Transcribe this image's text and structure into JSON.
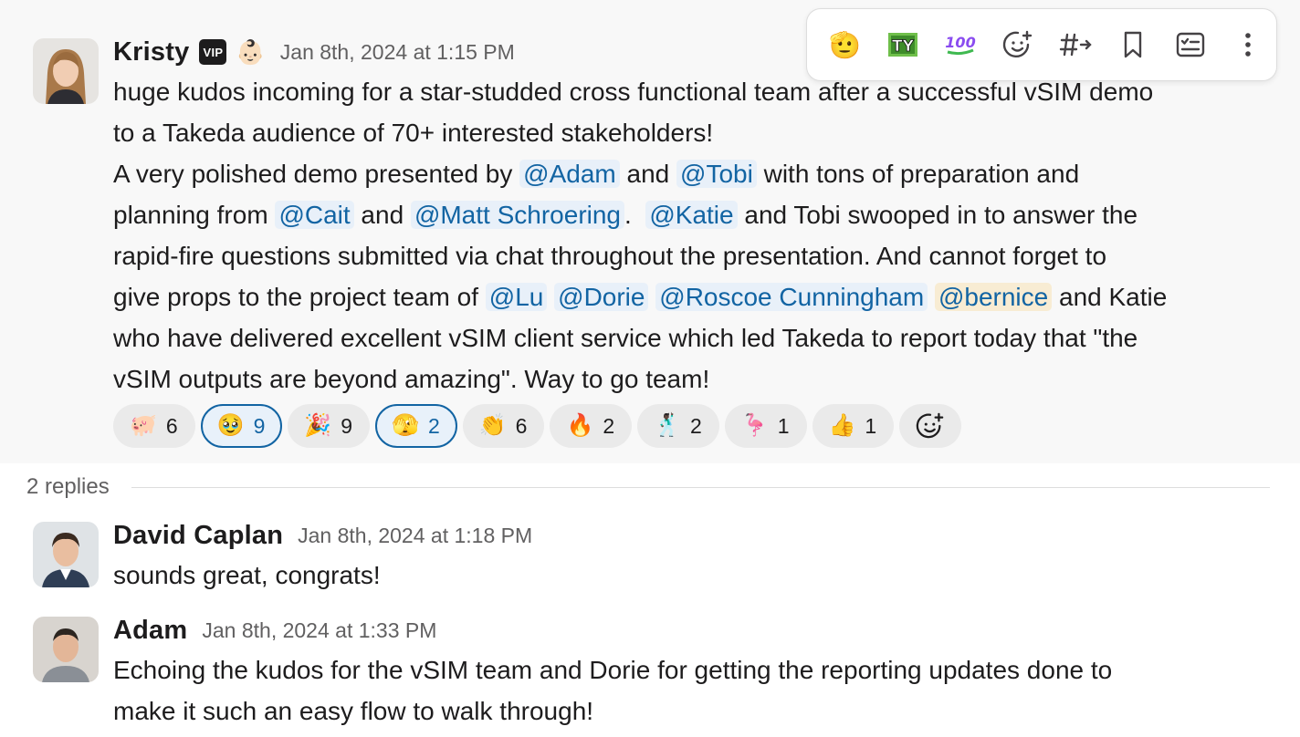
{
  "main_message": {
    "author": "Kristy",
    "badge": "VIP",
    "status_emoji": "👶🏻",
    "timestamp": "Jan 8th, 2024 at 1:15 PM",
    "lines": [
      [
        {
          "t": "huge kudos incoming for a star-studded cross functional team after a successful vSIM demo"
        }
      ],
      [
        {
          "t": "to a Takeda audience of 70+ interested stakeholders!"
        }
      ],
      [
        {
          "t": "A very polished demo presented by "
        },
        {
          "m": "@Adam"
        },
        {
          "t": " and "
        },
        {
          "m": "@Tobi"
        },
        {
          "t": " with tons of preparation and"
        }
      ],
      [
        {
          "t": "planning from "
        },
        {
          "m": "@Cait"
        },
        {
          "t": " and "
        },
        {
          "m": "@Matt Schroering"
        },
        {
          "t": ".  "
        },
        {
          "m": "@Katie"
        },
        {
          "t": " and Tobi swooped in to answer the"
        }
      ],
      [
        {
          "t": "rapid-fire questions submitted via chat throughout the presentation. And cannot forget to"
        }
      ],
      [
        {
          "t": "give props to the project team of "
        },
        {
          "m": "@Lu"
        },
        {
          "t": " "
        },
        {
          "m": "@Dorie"
        },
        {
          "t": " "
        },
        {
          "m": "@Roscoe Cunningham"
        },
        {
          "t": " "
        },
        {
          "m": "@bernice",
          "me": true
        },
        {
          "t": " and Katie"
        }
      ],
      [
        {
          "t": "who have delivered excellent vSIM client service which led Takeda to report today that \"the"
        }
      ],
      [
        {
          "t": "vSIM outputs are beyond amazing\". Way to go team!"
        }
      ]
    ],
    "reactions": [
      {
        "emoji": "🐖",
        "count": "6",
        "mine": false
      },
      {
        "emoji": "🥹",
        "count": "9",
        "mine": true
      },
      {
        "emoji": "🎉",
        "count": "9",
        "mine": false
      },
      {
        "emoji": "🫣",
        "count": "2",
        "mine": true
      },
      {
        "emoji": "👏",
        "count": "6",
        "mine": false
      },
      {
        "emoji": "🔥",
        "count": "2",
        "mine": false
      },
      {
        "emoji": "🕺🏿",
        "count": "2",
        "mine": false
      },
      {
        "emoji": "🦩",
        "count": "1",
        "mine": false
      },
      {
        "emoji": "👍",
        "count": "1",
        "mine": false
      }
    ]
  },
  "toolbar": {
    "items": [
      {
        "name": "emoji-salute-icon",
        "glyph": "🫡"
      },
      {
        "name": "emoji-ty-icon",
        "glyph": "TY"
      },
      {
        "name": "emoji-100-icon",
        "glyph": "💯"
      },
      {
        "name": "add-reaction-icon",
        "glyph": "☺"
      },
      {
        "name": "share-channel-icon",
        "glyph": "#→"
      },
      {
        "name": "bookmark-icon",
        "glyph": "🔖"
      },
      {
        "name": "add-to-list-icon",
        "glyph": "☑"
      },
      {
        "name": "more-actions-icon",
        "glyph": "⋮"
      }
    ]
  },
  "thread": {
    "replies_label": "2 replies"
  },
  "replies": [
    {
      "author": "David Caplan",
      "timestamp": "Jan 8th, 2024 at 1:18 PM",
      "lines": [
        "sounds great, congrats!"
      ]
    },
    {
      "author": "Adam",
      "timestamp": "Jan 8th, 2024 at 1:33 PM",
      "lines": [
        "Echoing the kudos for the vSIM team and Dorie for getting the reporting updates done to",
        "make it such an easy flow to walk through!"
      ]
    }
  ],
  "colors": {
    "mention_text": "#1264a3",
    "mention_bg": "#e8f0f9",
    "self_mention_bg": "#f8ecd3",
    "own_reaction_border": "#1264a3"
  }
}
